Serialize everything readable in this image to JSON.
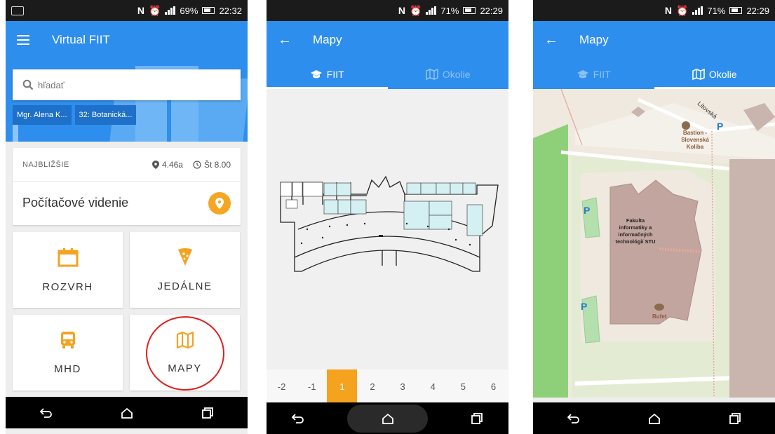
{
  "screen1": {
    "status": {
      "battery": "69%",
      "time": "22:32"
    },
    "appbar": {
      "title": "Virtual FIIT"
    },
    "search": {
      "placeholder": "hľadať"
    },
    "chips": [
      "Mgr. Alena K...",
      "32: Botanická..."
    ],
    "next": {
      "label": "NAJBLIŽŠIE",
      "room": "4.46a",
      "time": "Št 8.00",
      "subject": "Počítačové videnie"
    },
    "tiles": {
      "rozvrh": "ROZVRH",
      "jedalne": "JEDÁLNE",
      "mhd": "MHD",
      "mapy": "MAPY"
    }
  },
  "screen2": {
    "status": {
      "battery": "71%",
      "time": "22:29"
    },
    "appbar": {
      "title": "Mapy"
    },
    "tabs": {
      "fiit": "FIIT",
      "okolie": "Okolie",
      "active": "fiit"
    },
    "floors": [
      "-2",
      "-1",
      "1",
      "2",
      "3",
      "4",
      "5",
      "6"
    ],
    "active_floor": "1"
  },
  "screen3": {
    "status": {
      "battery": "71%",
      "time": "22:29"
    },
    "appbar": {
      "title": "Mapy"
    },
    "tabs": {
      "fiit": "FIIT",
      "okolie": "Okolie",
      "active": "okolie"
    },
    "map_labels": {
      "street": "Litovská",
      "bastion": "Bastion - Slovenská Koliba",
      "fiit_building": "Fakulta informatiky a informačných technológií STU",
      "bufet": "Bufet",
      "parking": "P"
    }
  },
  "colors": {
    "primary": "#2e8eee",
    "accent": "#f5a21f",
    "highlight_circle": "#e02020"
  }
}
